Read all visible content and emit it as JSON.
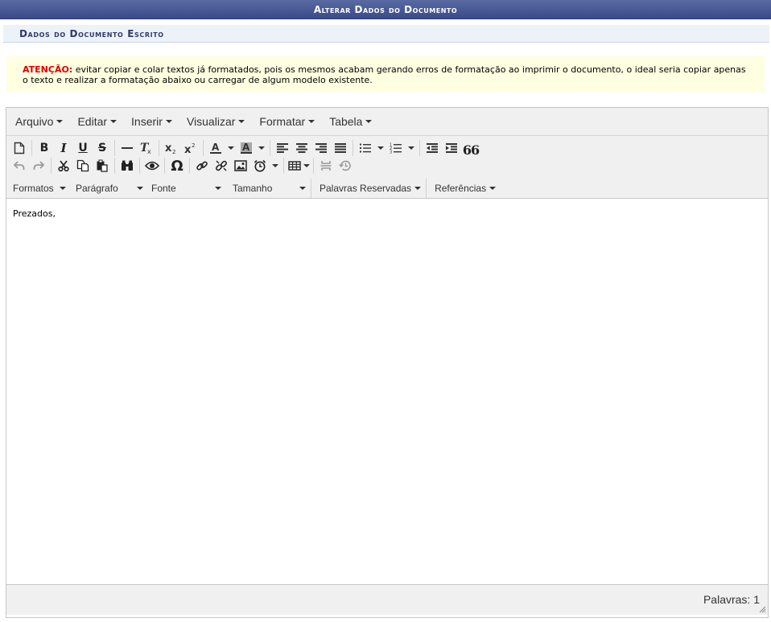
{
  "header": {
    "title": "Alterar Dados do Documento"
  },
  "section": {
    "title": "Dados do Documento Escrito"
  },
  "warning": {
    "label": "ATENÇÃO:",
    "text": " evitar copiar e colar textos já formatados, pois os mesmos acabam gerando erros de formatação ao imprimir o documento, o ideal seria copiar apenas o texto e realizar a formatação abaixo ou carregar de algum modelo existente.",
    "label_color": "#e00000",
    "background": "#ffffe1"
  },
  "menubar": {
    "file": "Arquivo",
    "edit": "Editar",
    "insert": "Inserir",
    "view": "Visualizar",
    "format": "Formatar",
    "table": "Tabela"
  },
  "toolbar": {
    "row1_icons": [
      "new-document-icon",
      "bold-icon",
      "italic-icon",
      "underline-icon",
      "strikethrough-icon",
      "horizontal-rule-icon",
      "clear-formatting-icon",
      "subscript-icon",
      "superscript-icon",
      "text-color-icon",
      "background-color-icon",
      "align-left-icon",
      "align-center-icon",
      "align-right-icon",
      "justify-icon",
      "bullet-list-icon",
      "numbered-list-icon",
      "outdent-icon",
      "indent-icon",
      "blockquote-icon"
    ],
    "row2_icons": [
      "undo-icon",
      "redo-icon",
      "cut-icon",
      "copy-icon",
      "paste-icon",
      "find-replace-icon",
      "preview-icon",
      "special-character-icon",
      "insert-link-icon",
      "remove-link-icon",
      "insert-image-icon",
      "insert-datetime-icon",
      "table-icon",
      "page-break-icon",
      "restore-draft-icon"
    ],
    "bold_glyph": "B",
    "italic_glyph": "I",
    "underline_glyph": "U",
    "strike_glyph": "S",
    "omega_glyph": "Ω",
    "quote_glyph": "66",
    "formats": "Formatos",
    "paragraph": "Parágrafo",
    "font": "Fonte",
    "size": "Tamanho",
    "reserved_words": "Palavras Reservadas",
    "references": "Referências"
  },
  "editor": {
    "content": "Prezados,"
  },
  "statusbar": {
    "word_count": "Palavras: 1"
  },
  "colors": {
    "header_bg": "#3a4a88",
    "section_bg": "#edf2f9",
    "toolbar_bg": "#f0f0f0"
  }
}
